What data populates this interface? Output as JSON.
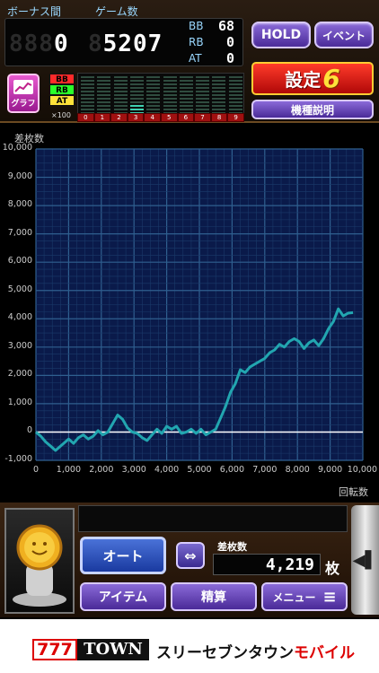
{
  "counter": {
    "bonus_label": "ボーナス間",
    "bonus_dim": "888",
    "bonus_value": "0",
    "game_label": "ゲーム数",
    "game_dim": "8",
    "game_value": "5207",
    "bb_label": "BB",
    "bb_value": "68",
    "rb_label": "RB",
    "rb_value": "0",
    "at_label": "AT",
    "at_value": "0"
  },
  "top_buttons": {
    "hold": "HOLD",
    "event": "イベント",
    "setting_label": "設定",
    "setting_value": "6",
    "machine_info": "機種説明"
  },
  "graph_button": {
    "label": "グラフ"
  },
  "mini_chart": {
    "legend": [
      {
        "label": "BB",
        "color": "#ff2a2a"
      },
      {
        "label": "RB",
        "color": "#2aff2a"
      },
      {
        "label": "AT",
        "color": "#ffe23a"
      }
    ],
    "multiplier": "×100",
    "axis": [
      "0",
      "1",
      "2",
      "3",
      "4",
      "5",
      "6",
      "7",
      "8",
      "9"
    ]
  },
  "chart_data": {
    "type": "line",
    "ylabel": "差枚数",
    "xlabel": "回転数",
    "xlim": [
      0,
      10000
    ],
    "ylim": [
      -1000,
      10000
    ],
    "xticks": [
      "0",
      "1,000",
      "2,000",
      "3,000",
      "4,000",
      "5,000",
      "6,000",
      "7,000",
      "8,000",
      "9,000",
      "10,000"
    ],
    "yticks": [
      "10,000",
      "9,000",
      "8,000",
      "7,000",
      "6,000",
      "5,000",
      "4,000",
      "3,000",
      "2,000",
      "1,000",
      "0",
      "-1,000"
    ],
    "grid": true,
    "line_color": "#22a6b0",
    "x": [
      0,
      150,
      300,
      450,
      600,
      750,
      850,
      1000,
      1150,
      1300,
      1450,
      1600,
      1750,
      1900,
      2050,
      2200,
      2350,
      2500,
      2650,
      2800,
      2950,
      3100,
      3250,
      3400,
      3550,
      3700,
      3850,
      4000,
      4150,
      4300,
      4450,
      4600,
      4750,
      4900,
      5050,
      5200,
      5350,
      5500,
      5650,
      5800,
      5950,
      6100,
      6250,
      6400,
      6550,
      6700,
      6850,
      7000,
      7150,
      7300,
      7450,
      7600,
      7750,
      7900,
      8050,
      8200,
      8350,
      8500,
      8650,
      8800,
      8950,
      9100,
      9250,
      9400,
      9550,
      9700
    ],
    "y": [
      0,
      -150,
      -350,
      -500,
      -650,
      -500,
      -400,
      -250,
      -400,
      -200,
      -100,
      -250,
      -150,
      50,
      -100,
      0,
      300,
      600,
      450,
      150,
      0,
      -50,
      -200,
      -300,
      -100,
      100,
      -50,
      200,
      100,
      200,
      -50,
      0,
      100,
      -50,
      100,
      -100,
      0,
      100,
      500,
      900,
      1400,
      1700,
      2200,
      2100,
      2300,
      2400,
      2500,
      2600,
      2800,
      2900,
      3100,
      3000,
      3200,
      3300,
      3200,
      2950,
      3150,
      3250,
      3050,
      3300,
      3650,
      3900,
      4350,
      4100,
      4200,
      4219
    ]
  },
  "bottom": {
    "auto_button": "オート",
    "swap_icon_label": "⇔",
    "diff_label": "差枚数",
    "diff_value": "4,219",
    "diff_unit": "枚",
    "item_button": "アイテム",
    "settle_button": "精算",
    "menu_button": "メニュー",
    "menu_icon": "≡",
    "side_tab_icon": "◀▌"
  },
  "footer": {
    "logo_777": "777",
    "logo_town": "TOWN",
    "text_main": "スリーセブンタウン",
    "text_red": "モバイル"
  }
}
